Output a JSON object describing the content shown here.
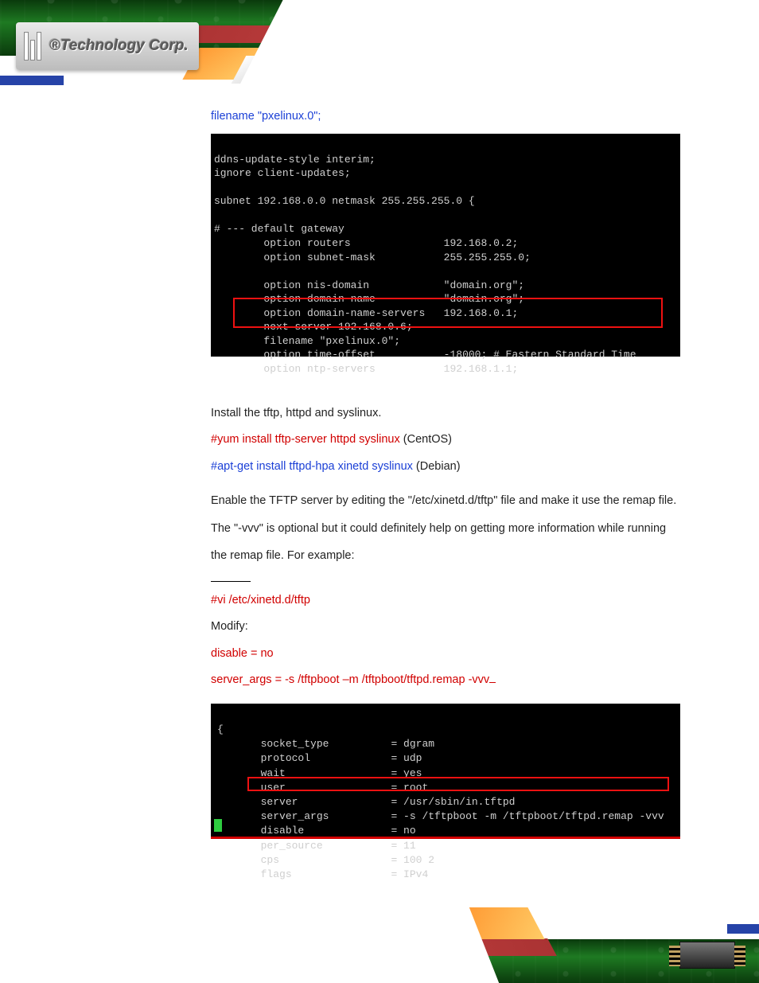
{
  "brand": {
    "logo_text": "®Technology Corp."
  },
  "line1": "filename \"pxelinux.0\";",
  "term1": {
    "l1": "ddns-update-style interim;",
    "l2": "ignore client-updates;",
    "l3": "subnet 192.168.0.0 netmask 255.255.255.0 {",
    "l4": "# --- default gateway",
    "l5a": "        option routers",
    "l5b": "192.168.0.2;",
    "l6a": "        option subnet-mask",
    "l6b": "255.255.255.0;",
    "l7a": "        option nis-domain",
    "l7b": "\"domain.org\";",
    "l8a": "        option domain-name",
    "l8b": "\"domain.org\";",
    "l9a": "        option domain-name-servers",
    "l9b": "192.168.0.1;",
    "l10": "        next-server 192.168.0.6;",
    "l11": "        filename \"pxelinux.0\";",
    "l12a": "        option time-offset",
    "l12b": "-18000; # Eastern Standard Time",
    "l13a": "        option ntp-servers",
    "l13b": "192.168.1.1;"
  },
  "p_install": "Install the tftp, httpd and syslinux.",
  "cmd_yum_red": "#yum install tftp-server httpd syslinux",
  "cmd_yum_note": " (CentOS)",
  "cmd_apt_blue": "#apt-get install tftpd-hpa xinetd syslinux",
  "cmd_apt_note": " (Debian)",
  "p_enable": "Enable the TFTP server by editing the \"/etc/xinetd.d/tftp\" file and make it use the remap file. The \"-vvv\" is optional but it could definitely help on getting more information while running the remap file. For example:",
  "cmd_vi": "#vi /etc/xinetd.d/tftp",
  "lbl_modify": "Modify:",
  "cfg_disable": "disable = no",
  "cfg_server_args": "server_args = -s /tftpboot –m /tftpboot/tftpd.remap -vvv",
  "term2": {
    "r1a": "       socket_type",
    "r1b": "= dgram",
    "r2a": "       protocol",
    "r2b": "= udp",
    "r3a": "       wait",
    "r3b": "= yes",
    "r4a": "       user",
    "r4b": "= root",
    "r5a": "       server",
    "r5b": "= /usr/sbin/in.tftpd",
    "r6a": "       server_args",
    "r6b": "= -s /tftpboot -m /tftpboot/tftpd.remap -vvv",
    "r7a": "       disable",
    "r7b": "= no",
    "r8a": "       per_source",
    "r8b": "= 11",
    "r9a": "       cps",
    "r9b": "= 100 2",
    "r10a": "       flags",
    "r10b": "= IPv4"
  }
}
